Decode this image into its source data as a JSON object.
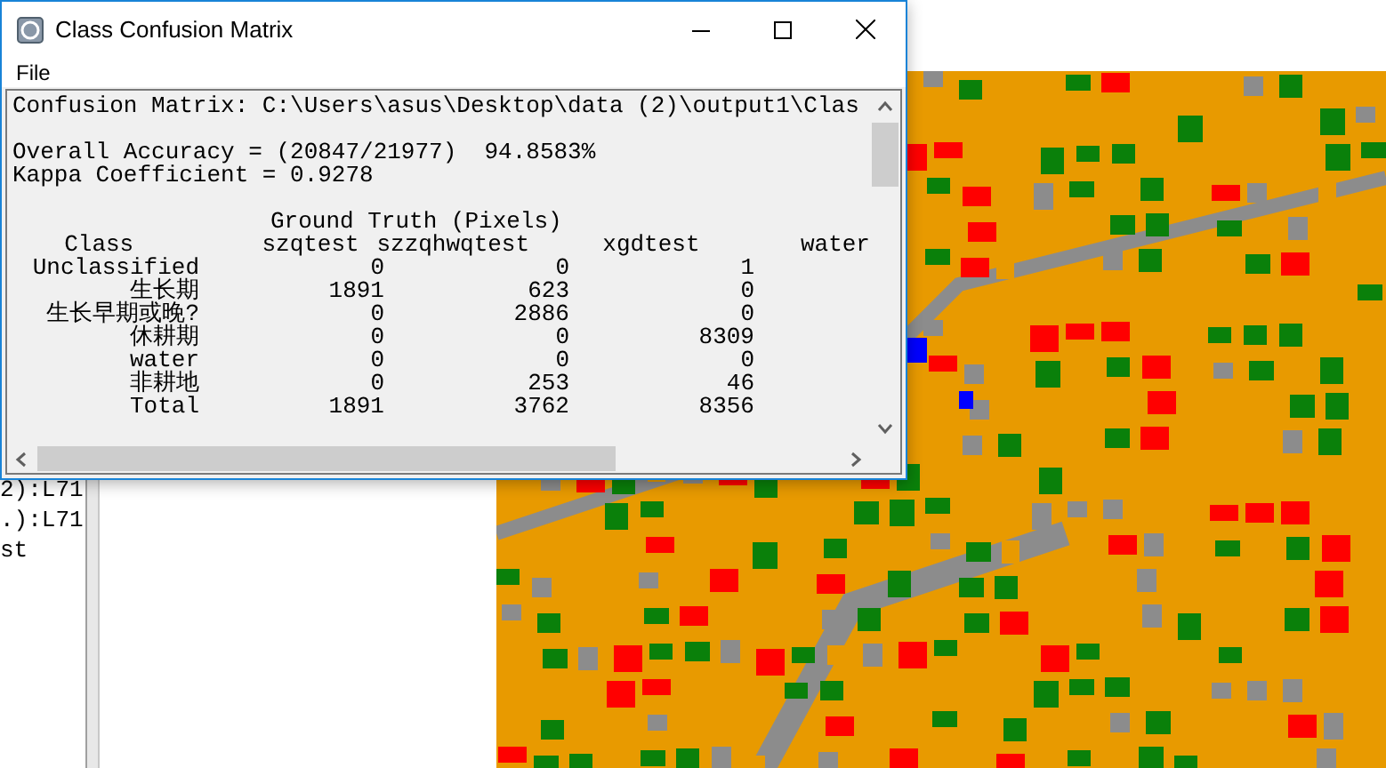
{
  "background": {
    "side_lines": [
      "2):L71",
      ".):L71",
      "st"
    ]
  },
  "window": {
    "title": "Class Confusion Matrix",
    "menu": [
      "File"
    ],
    "report": {
      "header_line": "Confusion Matrix: C:\\Users\\asus\\Desktop\\data (2)\\output1\\Clas",
      "accuracy_line": "Overall Accuracy = (20847/21977)  94.8583%",
      "kappa_line": "Kappa Coefficient = 0.9278",
      "group_heading": "Ground Truth (Pixels)",
      "columns": [
        "Class",
        "szqtest",
        "szzqhwqtest",
        "xgdtest",
        "water"
      ],
      "rows": [
        {
          "cells": [
            "Unclassified",
            "0",
            "0",
            "1"
          ]
        },
        {
          "cells": [
            "生长期",
            "1891",
            "623",
            "0"
          ]
        },
        {
          "cells": [
            "生长早期或晚?",
            "0",
            "2886",
            "0"
          ]
        },
        {
          "cells": [
            "休耕期",
            "0",
            "0",
            "8309"
          ]
        },
        {
          "cells": [
            "water",
            "0",
            "0",
            "0"
          ]
        },
        {
          "cells": [
            "非耕地",
            "0",
            "253",
            "46"
          ]
        },
        {
          "cells": [
            "Total",
            "1891",
            "3762",
            "8356"
          ]
        }
      ]
    }
  }
}
